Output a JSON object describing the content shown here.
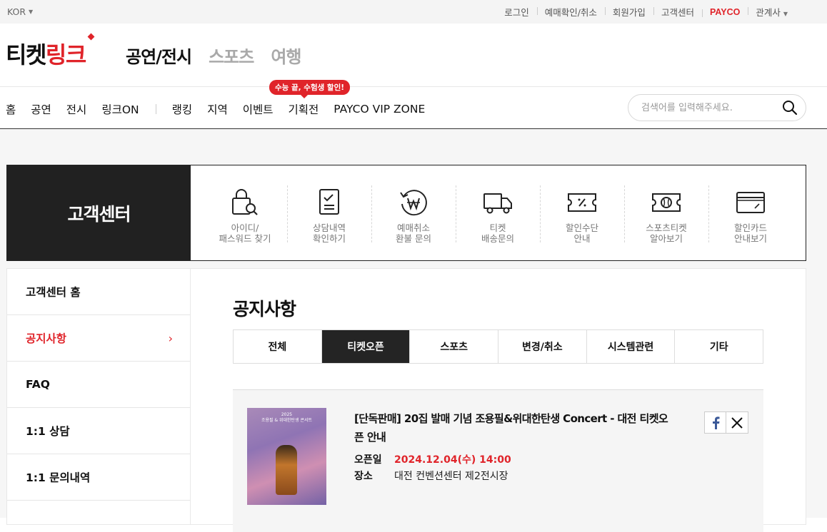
{
  "topbar": {
    "language": "KOR",
    "links": [
      "로그인",
      "예매확인/취소",
      "회원가입",
      "고객센터"
    ],
    "payco": "PAYCO",
    "partner": "관계사"
  },
  "logo": {
    "black": "티켓",
    "red": "링크"
  },
  "gnb": {
    "primary": "공연/전시",
    "secondary": [
      "스포츠",
      "여행"
    ]
  },
  "menu": {
    "group1": [
      "홈",
      "공연",
      "전시",
      "링크ON"
    ],
    "group2": [
      "랭킹",
      "지역",
      "이벤트",
      "기획전",
      "PAYCO VIP ZONE"
    ],
    "promo_badge": "수능 끝, 수험생 할인!"
  },
  "search": {
    "placeholder": "검색어를 입력해주세요."
  },
  "cs": {
    "title": "고객센터",
    "shortcuts": [
      {
        "line1": "아이디/",
        "line2": "패스워드 찾기",
        "icon": "lock-search-icon"
      },
      {
        "line1": "상담내역",
        "line2": "확인하기",
        "icon": "checklist-icon"
      },
      {
        "line1": "예매취소",
        "line2": "환불 문의",
        "icon": "refund-won-icon"
      },
      {
        "line1": "티켓",
        "line2": "배송문의",
        "icon": "delivery-truck-icon"
      },
      {
        "line1": "할인수단",
        "line2": "안내",
        "icon": "discount-ticket-icon"
      },
      {
        "line1": "스포츠티켓",
        "line2": "알아보기",
        "icon": "sports-ticket-icon"
      },
      {
        "line1": "할인카드",
        "line2": "안내보기",
        "icon": "discount-card-icon"
      }
    ]
  },
  "sidebar": {
    "items": [
      {
        "label": "고객센터 홈"
      },
      {
        "label": "공지사항"
      },
      {
        "label": "FAQ"
      },
      {
        "label": "1:1 상담"
      },
      {
        "label": "1:1 문의내역"
      }
    ]
  },
  "notice": {
    "heading": "공지사항",
    "tabs": [
      "전체",
      "티켓오픈",
      "스포츠",
      "변경/취소",
      "시스템관련",
      "기타"
    ],
    "selected_tab": "티켓오픈",
    "item": {
      "title": "[단독판매] 20집 발매 기념 조용필&위대한탄생 Concert - 대전 티켓오픈 안내",
      "open_label": "오픈일",
      "open_value": "2024.12.04(수) 14:00",
      "venue_label": "장소",
      "venue_value": "대전 컨벤션센터 제2전시장",
      "poster_year": "2025",
      "poster_caption": "조용필 & 위대한탄생 콘서트"
    }
  },
  "colors": {
    "accent": "#e0242a",
    "dark": "#212121"
  }
}
